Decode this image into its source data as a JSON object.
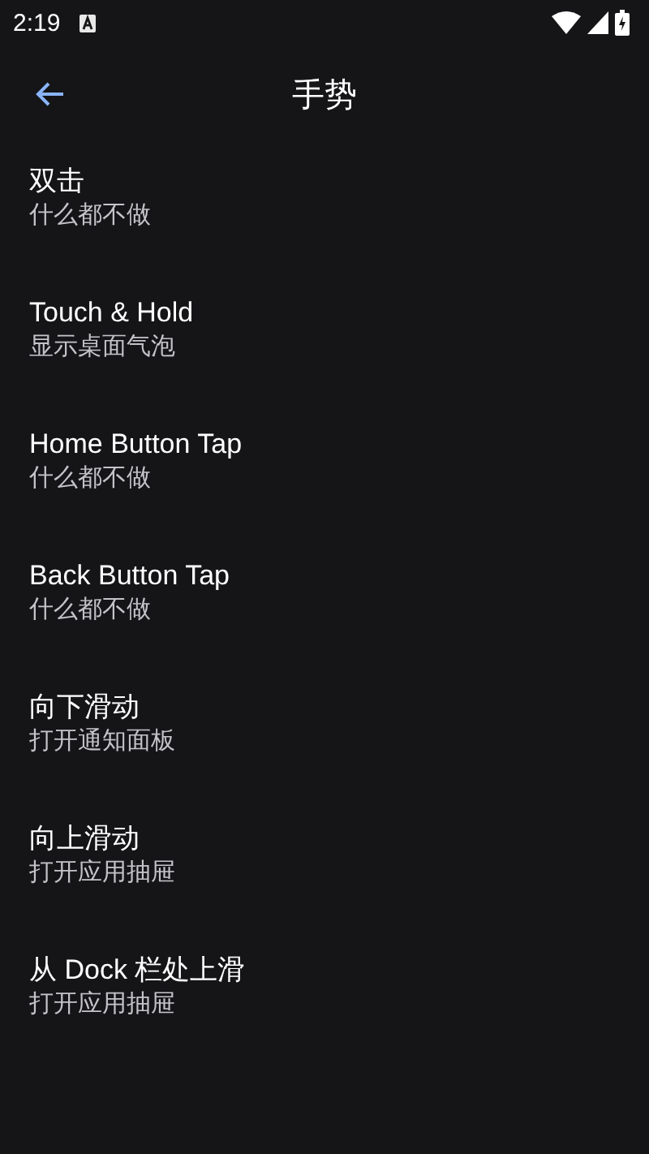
{
  "status_bar": {
    "time": "2:19"
  },
  "header": {
    "title": "手势"
  },
  "items": [
    {
      "title": "双击",
      "summary": "什么都不做"
    },
    {
      "title": "Touch & Hold",
      "summary": "显示桌面气泡"
    },
    {
      "title": "Home Button Tap",
      "summary": "什么都不做"
    },
    {
      "title": "Back Button Tap",
      "summary": "什么都不做"
    },
    {
      "title": "向下滑动",
      "summary": "打开通知面板"
    },
    {
      "title": "向上滑动",
      "summary": "打开应用抽屉"
    },
    {
      "title": "从 Dock 栏处上滑",
      "summary": "打开应用抽屉"
    }
  ]
}
